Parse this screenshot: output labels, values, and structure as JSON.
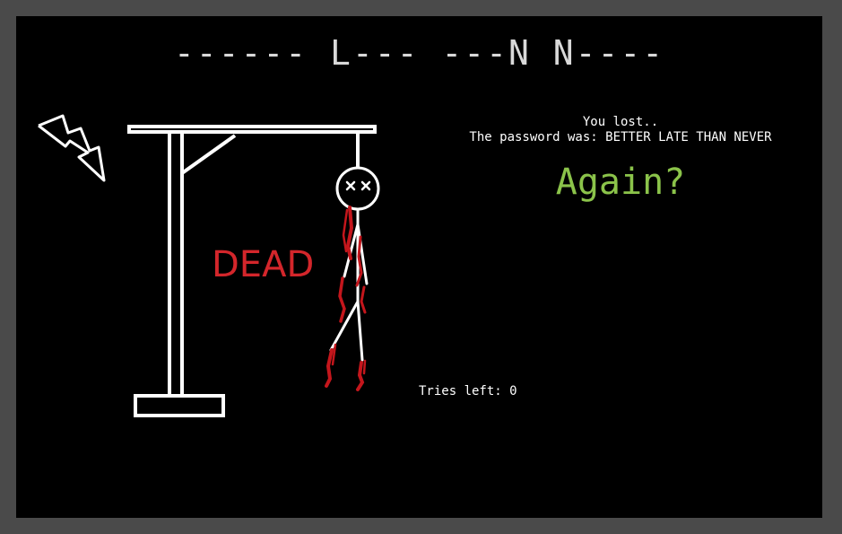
{
  "puzzle": {
    "masked_phrase": "------ L--- ---N N----"
  },
  "status": {
    "lost_text": "You lost..",
    "password_text": "The password was: BETTER LATE THAN NEVER"
  },
  "again_label": "Again?",
  "tries": {
    "label": "Tries left:",
    "value": "0"
  },
  "dead_label": "DEAD",
  "icons": {
    "lightning": "lightning-bolt-icon"
  },
  "colors": {
    "background": "#000000",
    "frame": "#4a4a4a",
    "text": "#d9d9d9",
    "again": "#8bc34a",
    "dead": "#d3262b",
    "blood": "#c4161c"
  }
}
